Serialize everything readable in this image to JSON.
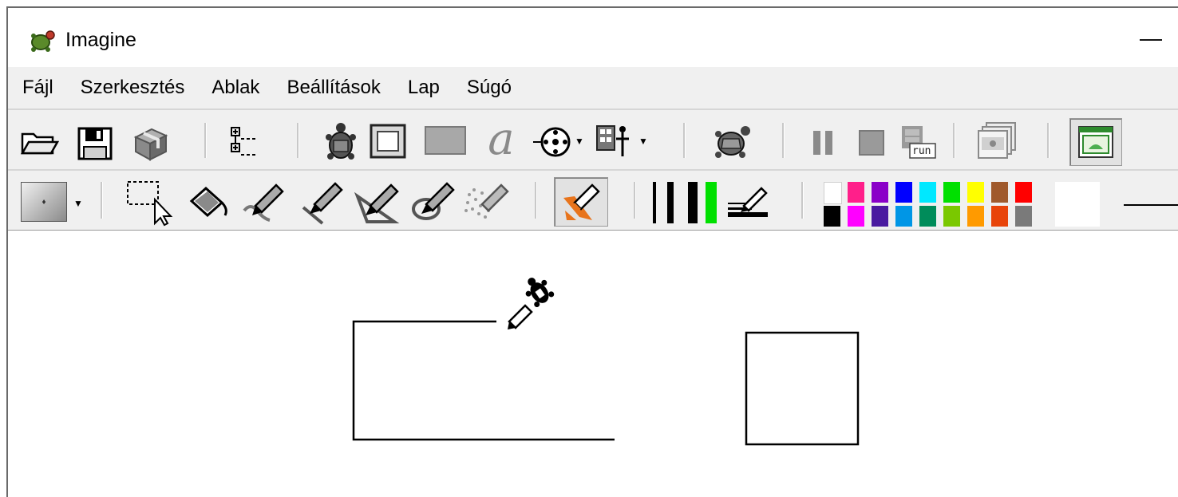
{
  "window": {
    "title": "Imagine",
    "minimize_label": "—"
  },
  "menu": {
    "items": [
      "Fájl",
      "Szerkesztés",
      "Ablak",
      "Beállítások",
      "Lap",
      "Súgó"
    ]
  },
  "toolbar_main": {
    "icons": [
      "open-folder-icon",
      "save-disk-icon",
      "package-icon",
      "procedures-list-icon",
      "new-turtle-icon",
      "new-pane-icon",
      "new-shape-icon",
      "new-text-icon",
      "new-control-icon",
      "new-object-icon",
      "turtle-icon",
      "pause-icon",
      "stop-icon",
      "run-icon",
      "pages-icon",
      "page-view-icon"
    ],
    "run_label": "run"
  },
  "toolbar_draw": {
    "icons": [
      "shape-picker-icon",
      "select-tool-icon",
      "fill-tool-icon",
      "freehand-pen-icon",
      "line-pen-icon",
      "polygon-pen-icon",
      "ellipse-pen-icon",
      "spray-icon",
      "eraser-icon",
      "pen-width-thin-icon",
      "pen-width-medium-icon",
      "pen-width-thick-icon",
      "pen-width-custom-icon"
    ],
    "palette": {
      "top": [
        "#ffffff",
        "#ff1f8a",
        "#8a00c8",
        "#0000ff",
        "#00e8ff",
        "#00e000",
        "#ffff00",
        "#a05a2c",
        "#ff0000"
      ],
      "bottom": [
        "#000000",
        "#ff00ff",
        "#4a1aa0",
        "#0096e6",
        "#008c5a",
        "#7ac800",
        "#ff9a00",
        "#e8440a",
        "#7a7a7a"
      ]
    },
    "current_color": "#ffffff",
    "pen_width_accent": "#00e000"
  },
  "canvas": {
    "turtle_icon": "turtle-sprite-icon",
    "pen_icon": "pen-cursor-icon"
  }
}
